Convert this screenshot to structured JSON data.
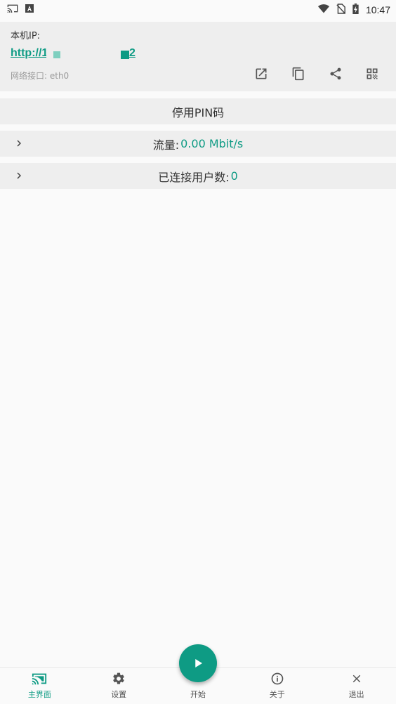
{
  "status_bar": {
    "time": "10:47",
    "left_icons": [
      "cast-icon",
      "a-notification-icon"
    ],
    "right_icons": [
      "wifi-icon",
      "no-sim-icon",
      "battery-charging-icon"
    ]
  },
  "ip_card": {
    "label": "本机IP:",
    "url_prefix": "http://1",
    "url_suffix": "2",
    "interface_text": "网络接口: eth0",
    "actions": [
      "open-external-icon",
      "copy-icon",
      "share-icon",
      "qr-code-icon"
    ]
  },
  "pin_row": {
    "label": "停用PIN码"
  },
  "traffic_row": {
    "label": "流量:",
    "value": "0.00 Mbit/s"
  },
  "users_row": {
    "label": "已连接用户数:",
    "value": "0"
  },
  "bottom_nav": {
    "items": [
      {
        "label": "主界面",
        "icon": "cast-icon",
        "active": true
      },
      {
        "label": "设置",
        "icon": "gear-icon",
        "active": false
      },
      {
        "label": "开始",
        "icon": "play-icon",
        "active": false
      },
      {
        "label": "关于",
        "icon": "info-icon",
        "active": false
      },
      {
        "label": "退出",
        "icon": "close-icon",
        "active": false
      }
    ]
  },
  "colors": {
    "accent": "#0e9b84",
    "card_bg": "#eeeeee",
    "page_bg": "#fafafa"
  }
}
